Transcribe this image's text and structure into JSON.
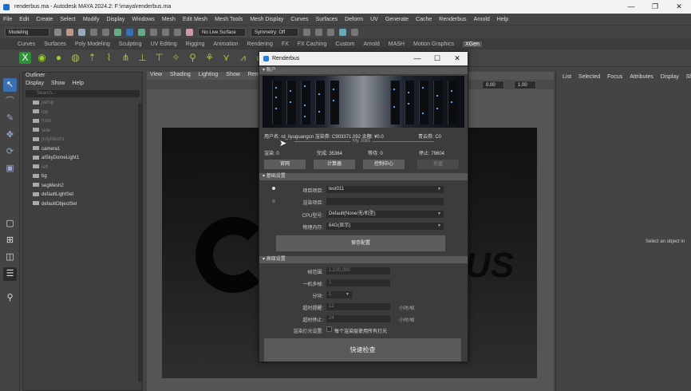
{
  "window": {
    "title": "renderbus.ma - Autodesk MAYA 2024.2: F:\\maya\\renderbus.ma",
    "controls": [
      "—",
      "❐",
      "✕"
    ]
  },
  "menubar": [
    "File",
    "Edit",
    "Create",
    "Select",
    "Modify",
    "Display",
    "Windows",
    "Mesh",
    "Edit Mesh",
    "Mesh Tools",
    "Mesh Display",
    "Curves",
    "Surfaces",
    "Deform",
    "UV",
    "Generate",
    "Cache",
    "Renderbus",
    "Arnold",
    "Help"
  ],
  "statusline": {
    "mode": "Modeling",
    "live_surface": "No Live Surface",
    "symmetry": "Symmetry: Off"
  },
  "shelf_tabs": [
    "Curves",
    "Surfaces",
    "Poly Modeling",
    "Sculpting",
    "UV Editing",
    "Rigging",
    "Animation",
    "Rendering",
    "FX",
    "FX Caching",
    "Custom",
    "Arnold",
    "MASH",
    "Motion Graphics",
    "XGen"
  ],
  "shelf_active_tab": "XGen",
  "outliner": {
    "title": "Outliner",
    "menu": [
      "Display",
      "Show",
      "Help"
    ],
    "search_placeholder": "Search...",
    "items": [
      {
        "label": "persp",
        "dim": true
      },
      {
        "label": "top",
        "dim": true
      },
      {
        "label": "front",
        "dim": true
      },
      {
        "label": "side",
        "dim": true
      },
      {
        "label": "polyMesh1",
        "dim": true
      },
      {
        "label": "camera1",
        "dim": false
      },
      {
        "label": "aiSkyDomeLight1",
        "dim": false
      },
      {
        "label": "left",
        "dim": true
      },
      {
        "label": "bg",
        "dim": false
      },
      {
        "label": "segMesh2",
        "dim": false
      },
      {
        "label": "defaultLightSet",
        "dim": false
      },
      {
        "label": "defaultObjectSet",
        "dim": false
      }
    ]
  },
  "viewport": {
    "menu": [
      "View",
      "Shading",
      "Lighting",
      "Show",
      "Rendr"
    ],
    "field1": "0.00",
    "field2": "1.00",
    "logo_text": "US"
  },
  "attribute_panel": {
    "menu": [
      "List",
      "Selected",
      "Focus",
      "Attributes",
      "Display",
      "Show"
    ],
    "hint": "Select an object in"
  },
  "dialog": {
    "title": "Renderbus",
    "controls": [
      "—",
      "☐",
      "✕"
    ],
    "account_header": "账户",
    "user_line": "用户名: rd_liyuguangcn  渲染券: C903371.092  余额: ¥0.0",
    "coupon": "青云券: C0",
    "myjobs": "My Jobs",
    "stats": {
      "rendering": "渲染: 0",
      "done": "完成: 35364",
      "waiting": "等待: 0",
      "stopped": "停止: 79604"
    },
    "buttons": [
      "官网",
      "计算器",
      "控制中心",
      "充值"
    ],
    "basic_header": "基础设置",
    "project_label": "项目项目:",
    "project_value": "test011",
    "subproject_label": "渲染项目:",
    "subproject_value": "",
    "cpu_label": "CPU型号:",
    "cpu_value": "Default(None/无/机型)",
    "memory_label": "物理内存:",
    "memory_value": "64G(显示)",
    "save_button": "保存配置",
    "advanced_header": "高级设置",
    "frames_label": "帧范围:",
    "frames_value": "1,100,200",
    "machines_label": "一机多帧:",
    "machines_value": "1",
    "split_label": "分块:",
    "split_value": "1",
    "timeout_remind_label": "超时提醒:",
    "timeout_remind_value": "12",
    "timeout_remind_unit": "小时/帧",
    "timeout_stop_label": "超时停止:",
    "timeout_stop_value": "24",
    "timeout_stop_unit": "小时/帧",
    "light_label": "渲染灯光设置:",
    "light_checkbox_label": "每个渲染层使用所有灯光",
    "quick_check": "快速检查"
  }
}
